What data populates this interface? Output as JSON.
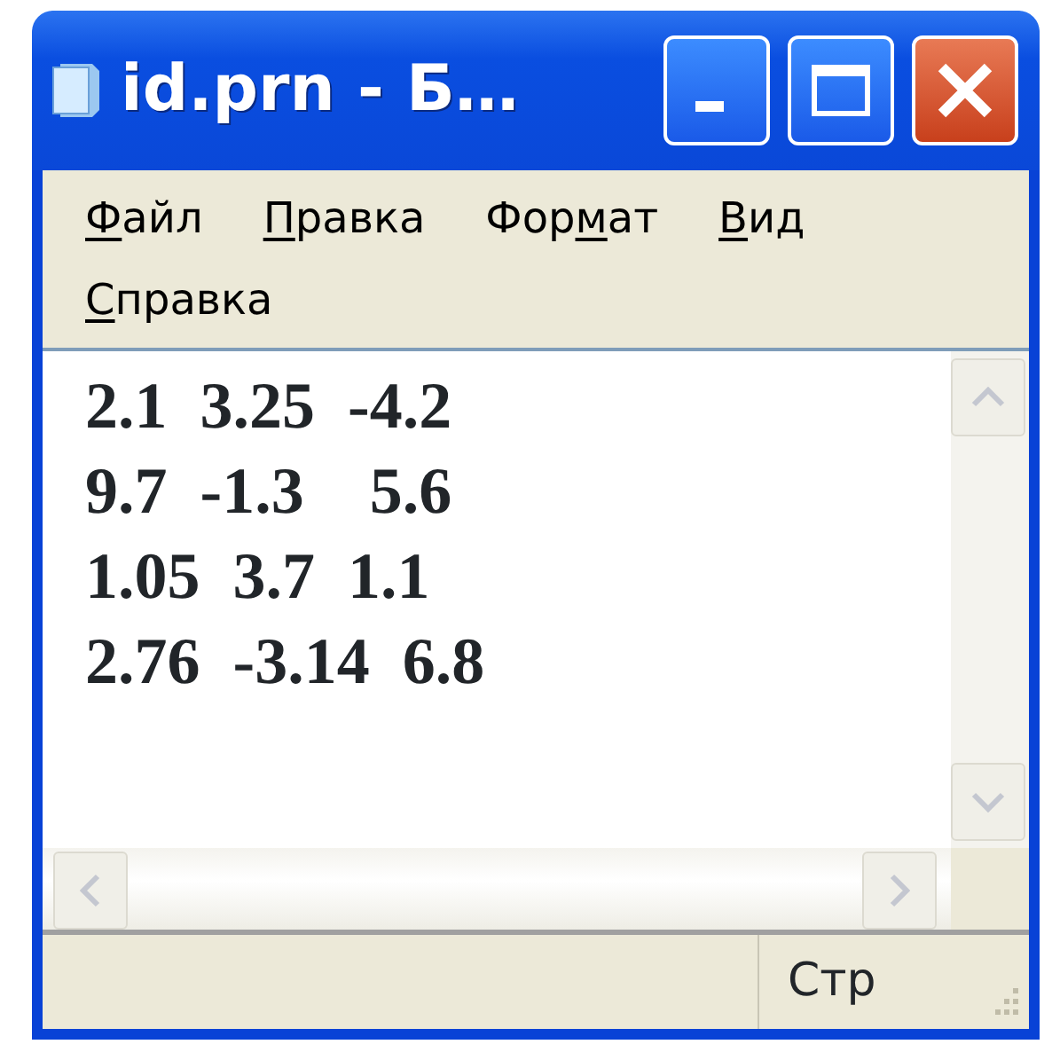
{
  "window": {
    "title": "id.prn - Б…"
  },
  "menu": [
    {
      "key": "Ф",
      "after": "айл"
    },
    {
      "key": "П",
      "after": "равка"
    },
    {
      "before": "Фор",
      "key": "м",
      "after": "ат"
    },
    {
      "key": "В",
      "after": "ид"
    },
    {
      "key": "С",
      "after": "правка"
    }
  ],
  "editor": {
    "lines": [
      "2.1  3.25  -4.2",
      "9.7  -1.3    5.6",
      "1.05  3.7  1.1",
      "2.76  -3.14  6.8"
    ]
  },
  "status_bar": {
    "position": "Стр"
  }
}
